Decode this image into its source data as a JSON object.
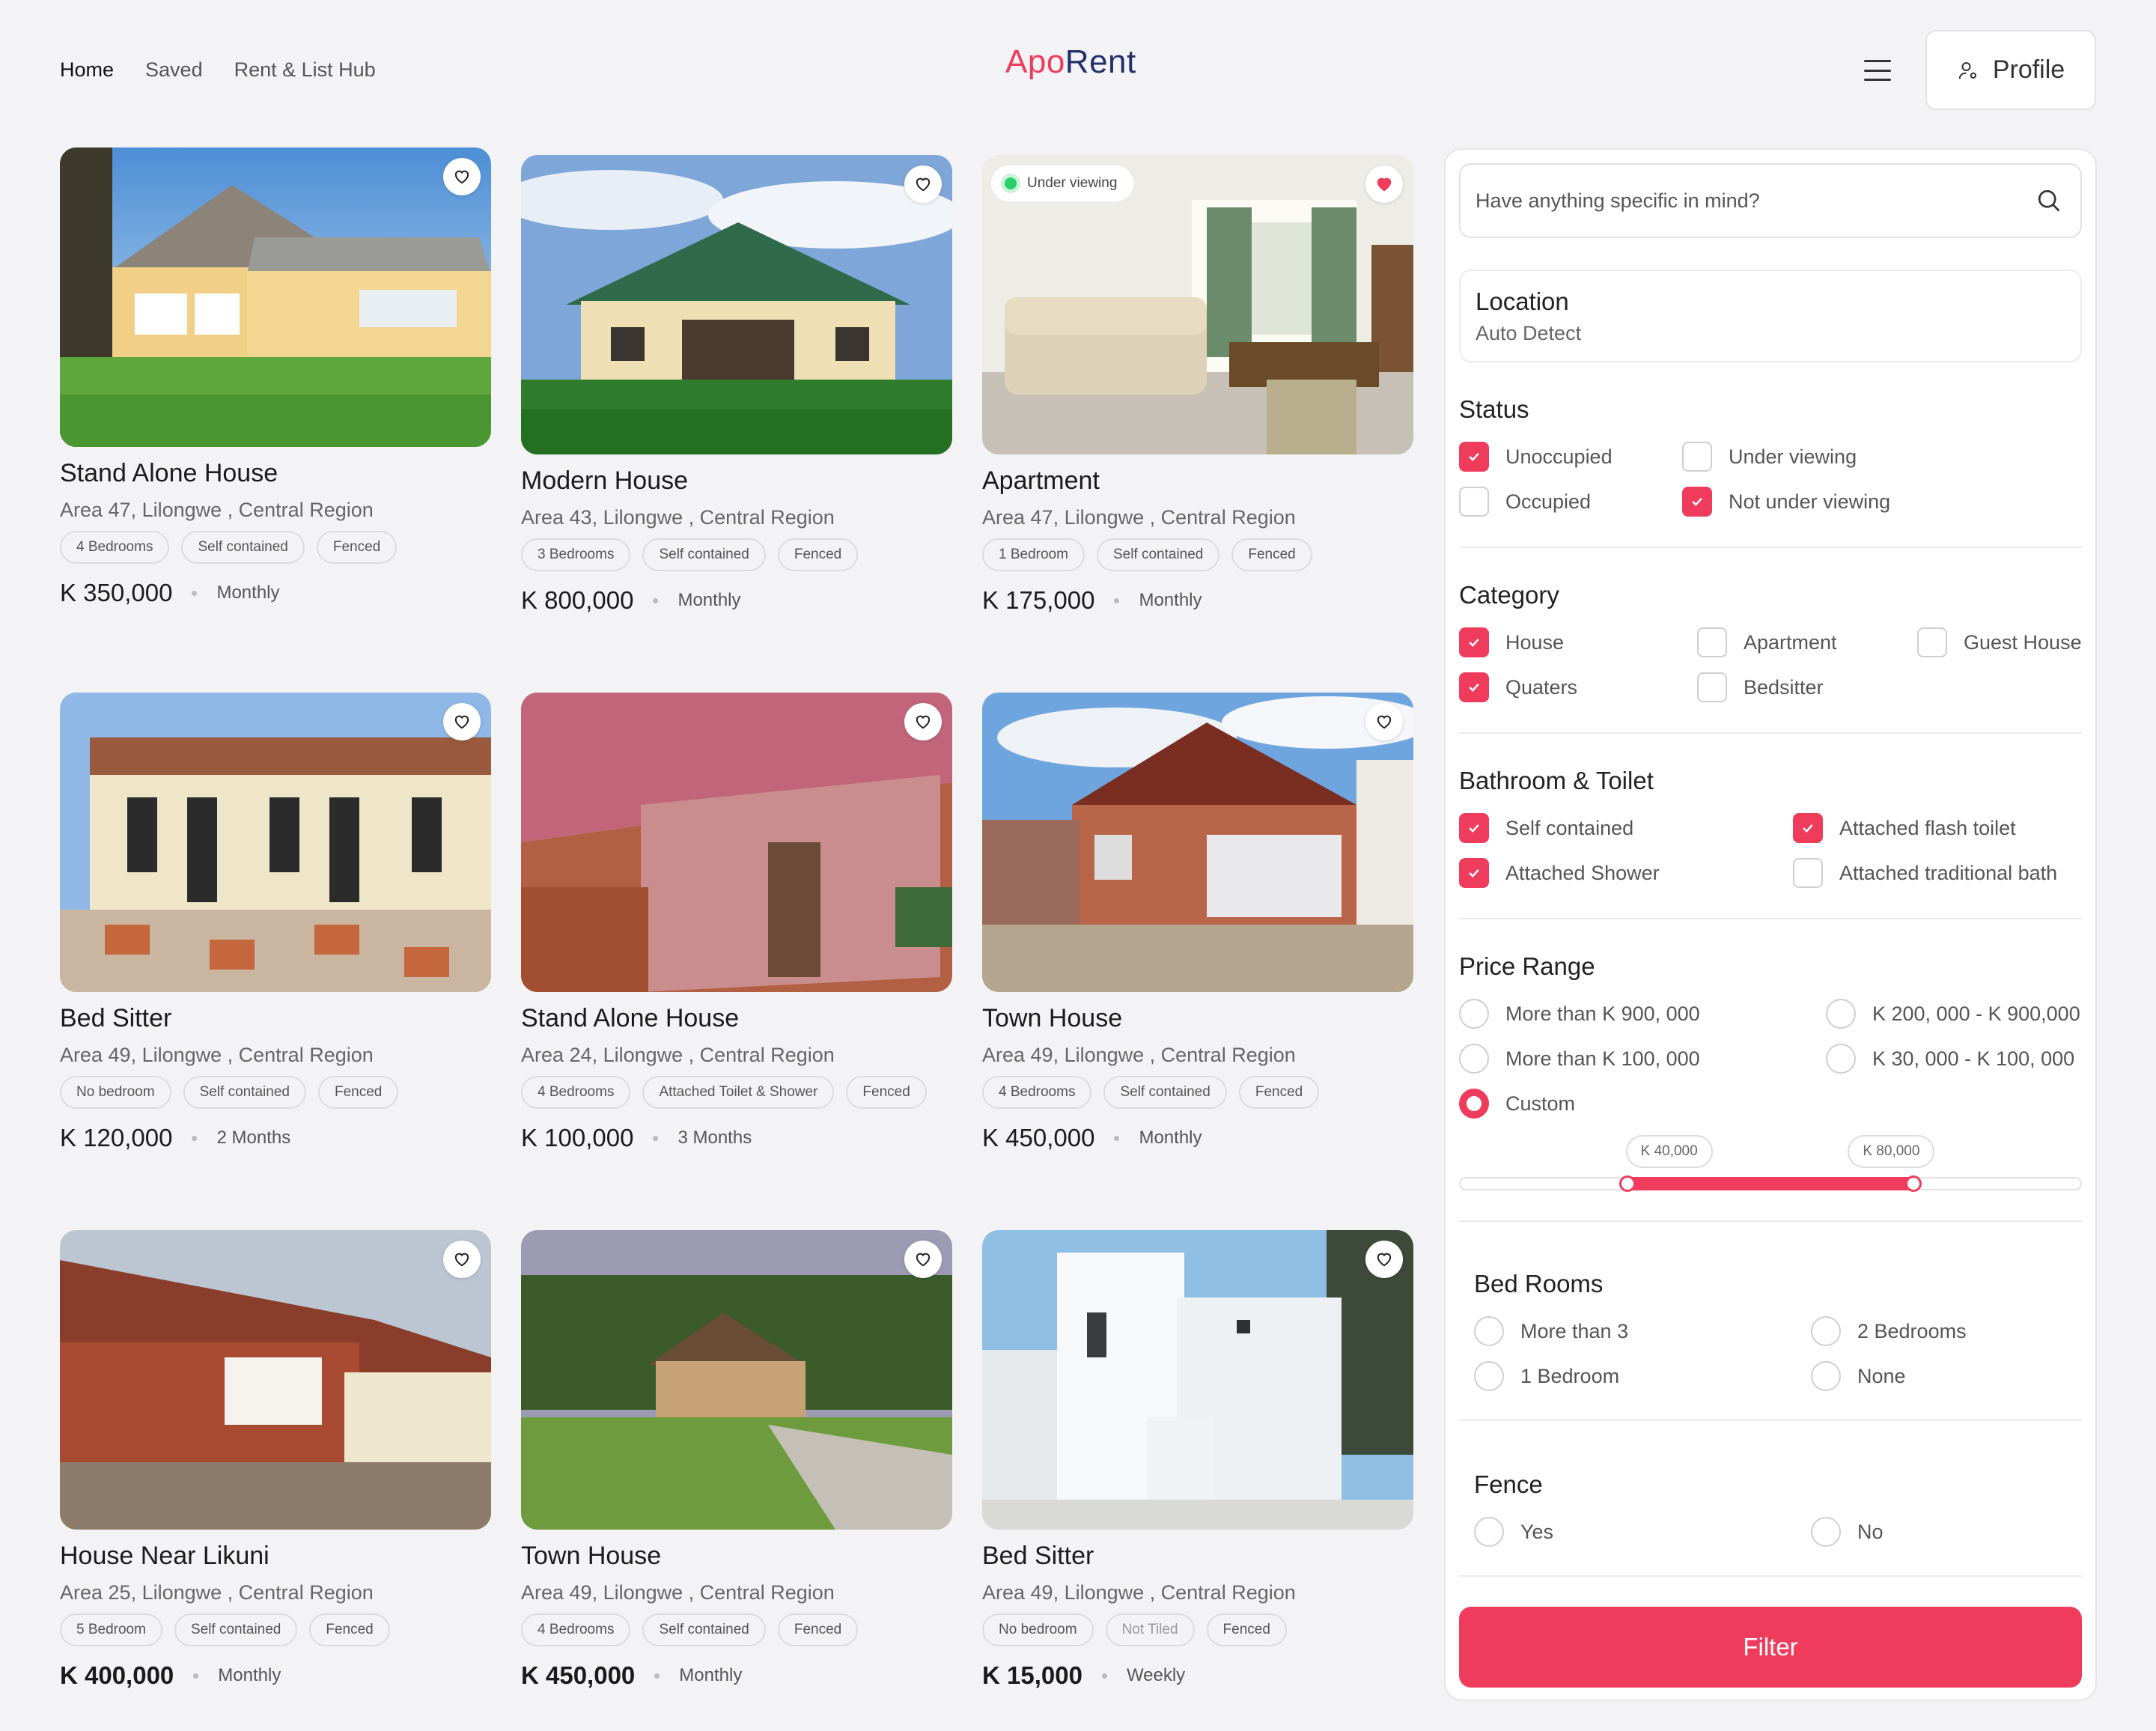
{
  "nav": {
    "home": "Home",
    "saved": "Saved",
    "hub": "Rent & List Hub"
  },
  "logo": {
    "part1": "Apo",
    "part2": "Rent"
  },
  "profile": {
    "label": "Profile"
  },
  "colors": {
    "accent": "#ef3c5d",
    "brand_dark": "#24306a",
    "background": "#f3f3f5"
  },
  "listings": [
    {
      "title": "Stand Alone House",
      "address": "Area 47, Lilongwe , Central Region",
      "tags": [
        "4 Bedrooms",
        "Self contained",
        "Fenced"
      ],
      "price": "K 350,000",
      "period": "Monthly",
      "favorite": false
    },
    {
      "title": "Modern House",
      "address": "Area 43, Lilongwe , Central Region",
      "tags": [
        "3 Bedrooms",
        "Self contained",
        "Fenced"
      ],
      "price": "K 800,000",
      "period": "Monthly",
      "favorite": false
    },
    {
      "title": "Apartment",
      "address": "Area 47, Lilongwe , Central Region",
      "tags": [
        "1 Bedroom",
        "Self contained",
        "Fenced"
      ],
      "price": "K 175,000",
      "period": "Monthly",
      "favorite": true,
      "badge": "Under viewing"
    },
    {
      "title": "Bed Sitter",
      "address": "Area 49, Lilongwe , Central Region",
      "tags": [
        "No bedroom",
        "Self contained",
        "Fenced"
      ],
      "price": "K 120,000",
      "period": "2 Months",
      "favorite": false
    },
    {
      "title": "Stand Alone House",
      "address": "Area 24, Lilongwe , Central Region",
      "tags": [
        "4 Bedrooms",
        "Attached Toilet & Shower",
        "Fenced"
      ],
      "price": "K 100,000",
      "period": "3 Months",
      "favorite": false
    },
    {
      "title": "Town House",
      "address": "Area 49, Lilongwe , Central Region",
      "tags": [
        "4 Bedrooms",
        "Self contained",
        "Fenced"
      ],
      "price": "K 450,000",
      "period": "Monthly",
      "favorite": false
    },
    {
      "title": "House Near Likuni",
      "address": "Area 25, Lilongwe , Central Region",
      "tags": [
        "5 Bedroom",
        "Self contained",
        "Fenced"
      ],
      "price": "K 400,000",
      "period": "Monthly",
      "favorite": false
    },
    {
      "title": "Town House",
      "address": "Area 49, Lilongwe , Central Region",
      "tags": [
        "4 Bedrooms",
        "Self contained",
        "Fenced"
      ],
      "price": "K 450,000",
      "period": "Monthly",
      "favorite": false
    },
    {
      "title": "Bed Sitter",
      "address": "Area 49, Lilongwe , Central Region",
      "tags": [
        "No bedroom",
        "Not Tiled",
        "Fenced"
      ],
      "price": "K 15,000",
      "period": "Weekly",
      "favorite": false
    }
  ],
  "filters": {
    "search_placeholder": "Have anything specific in mind?",
    "location": {
      "label": "Location",
      "value": "Auto Detect"
    },
    "status": {
      "title": "Status",
      "unoccupied": "Unoccupied",
      "under_viewing": "Under viewing",
      "occupied": "Occupied",
      "not_under_viewing": "Not under viewing"
    },
    "category": {
      "title": "Category",
      "house": "House",
      "apartment": "Apartment",
      "guest_house": "Guest House",
      "quaters": "Quaters",
      "bedsitter": "Bedsitter"
    },
    "bathroom": {
      "title": "Bathroom & Toilet",
      "self_contained": "Self contained",
      "attached_flash": "Attached flash toilet",
      "attached_shower": "Attached Shower",
      "attached_bath": "Attached traditional bath"
    },
    "price": {
      "title": "Price Range",
      "more_900": "More than K 900, 000",
      "range_200_900": "K 200, 000 - K 900,000",
      "more_100": "More than K 100, 000",
      "range_30_100": "K 30, 000 - K 100, 000",
      "custom": "Custom",
      "min_label": "K 40,000",
      "max_label": "K 80,000",
      "min_fraction": 0.27,
      "max_fraction": 0.73
    },
    "bedrooms": {
      "title": "Bed Rooms",
      "more_3": "More than 3",
      "two": "2 Bedrooms",
      "one": "1 Bedroom",
      "none": "None"
    },
    "fence": {
      "title": "Fence",
      "yes": "Yes",
      "no": "No"
    },
    "button": "Filter"
  }
}
